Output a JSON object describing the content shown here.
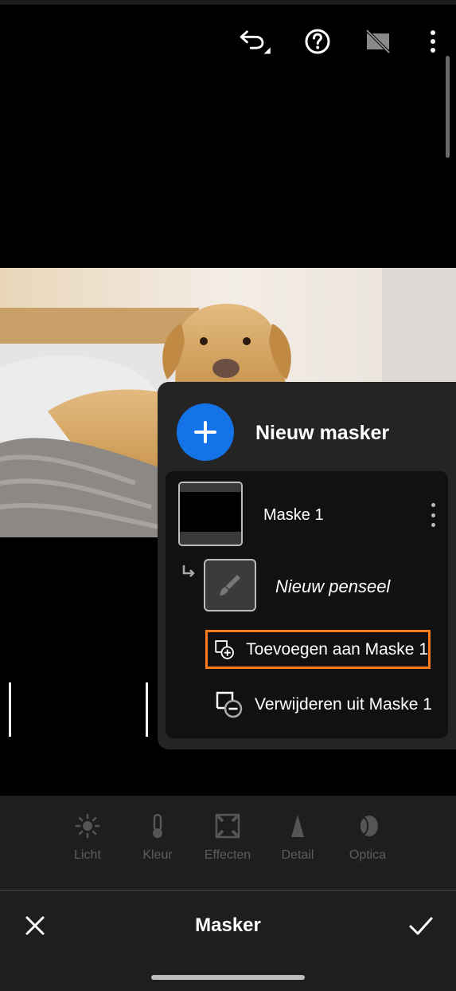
{
  "toolbar": {
    "icons": [
      "undo-icon",
      "help-icon",
      "before-after-icon",
      "more-icon"
    ]
  },
  "mask_panel": {
    "new_mask_label": "Nieuw masker",
    "mask_name": "Maske 1",
    "brush_label": "Nieuw penseel",
    "add_label": "Toevoegen aan Maske 1",
    "remove_label": "Verwijderen uit Maske 1"
  },
  "tools": [
    {
      "label": "Licht",
      "icon": "sun-icon"
    },
    {
      "label": "Kleur",
      "icon": "thermometer-icon"
    },
    {
      "label": "Effecten",
      "icon": "vignette-icon"
    },
    {
      "label": "Detail",
      "icon": "triangle-icon"
    },
    {
      "label": "Optica",
      "icon": "lens-icon"
    }
  ],
  "action_bar": {
    "title": "Masker"
  },
  "colors": {
    "accent": "#1473e6",
    "highlight": "#ff7a1a"
  }
}
